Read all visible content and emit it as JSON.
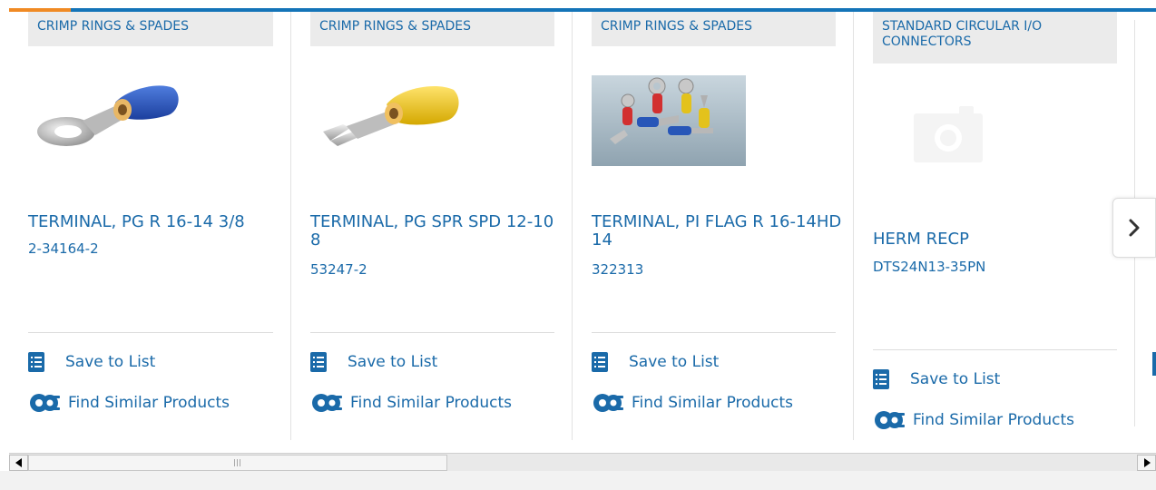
{
  "carousel": {
    "products": [
      {
        "category": "CRIMP RINGS & SPADES",
        "image": "ring-terminal-blue",
        "title": "TERMINAL, PG R 16-14 3/8",
        "part_number": "2-34164-2",
        "save_label": "Save to List",
        "find_label": "Find Similar Products"
      },
      {
        "category": "CRIMP RINGS & SPADES",
        "image": "spade-terminal-yellow",
        "title": "TERMINAL, PG SPR SPD 12-10 8",
        "part_number": "53247-2",
        "save_label": "Save to List",
        "find_label": "Find Similar Products"
      },
      {
        "category": "CRIMP RINGS & SPADES",
        "image": "assorted-terminals-photo",
        "title": "TERMINAL, PI FLAG R 16-14HD 14",
        "part_number": "322313",
        "save_label": "Save to List",
        "find_label": "Find Similar Products"
      },
      {
        "category": "STANDARD CIRCULAR I/O CONNECTORS",
        "image": "camera-placeholder-icon",
        "title": "HERM RECP",
        "part_number": "DTS24N13-35PN",
        "save_label": "Save to List",
        "find_label": "Find Similar Products"
      }
    ],
    "next_icon": "chevron-right-icon"
  },
  "colors": {
    "link": "#1a6aa9",
    "top_bar": "#1474b8",
    "top_bar_accent": "#f08a24",
    "category_bg": "#ebebeb"
  },
  "scrollbar": {
    "left_icon": "triangle-left-icon",
    "right_icon": "triangle-right-icon"
  }
}
